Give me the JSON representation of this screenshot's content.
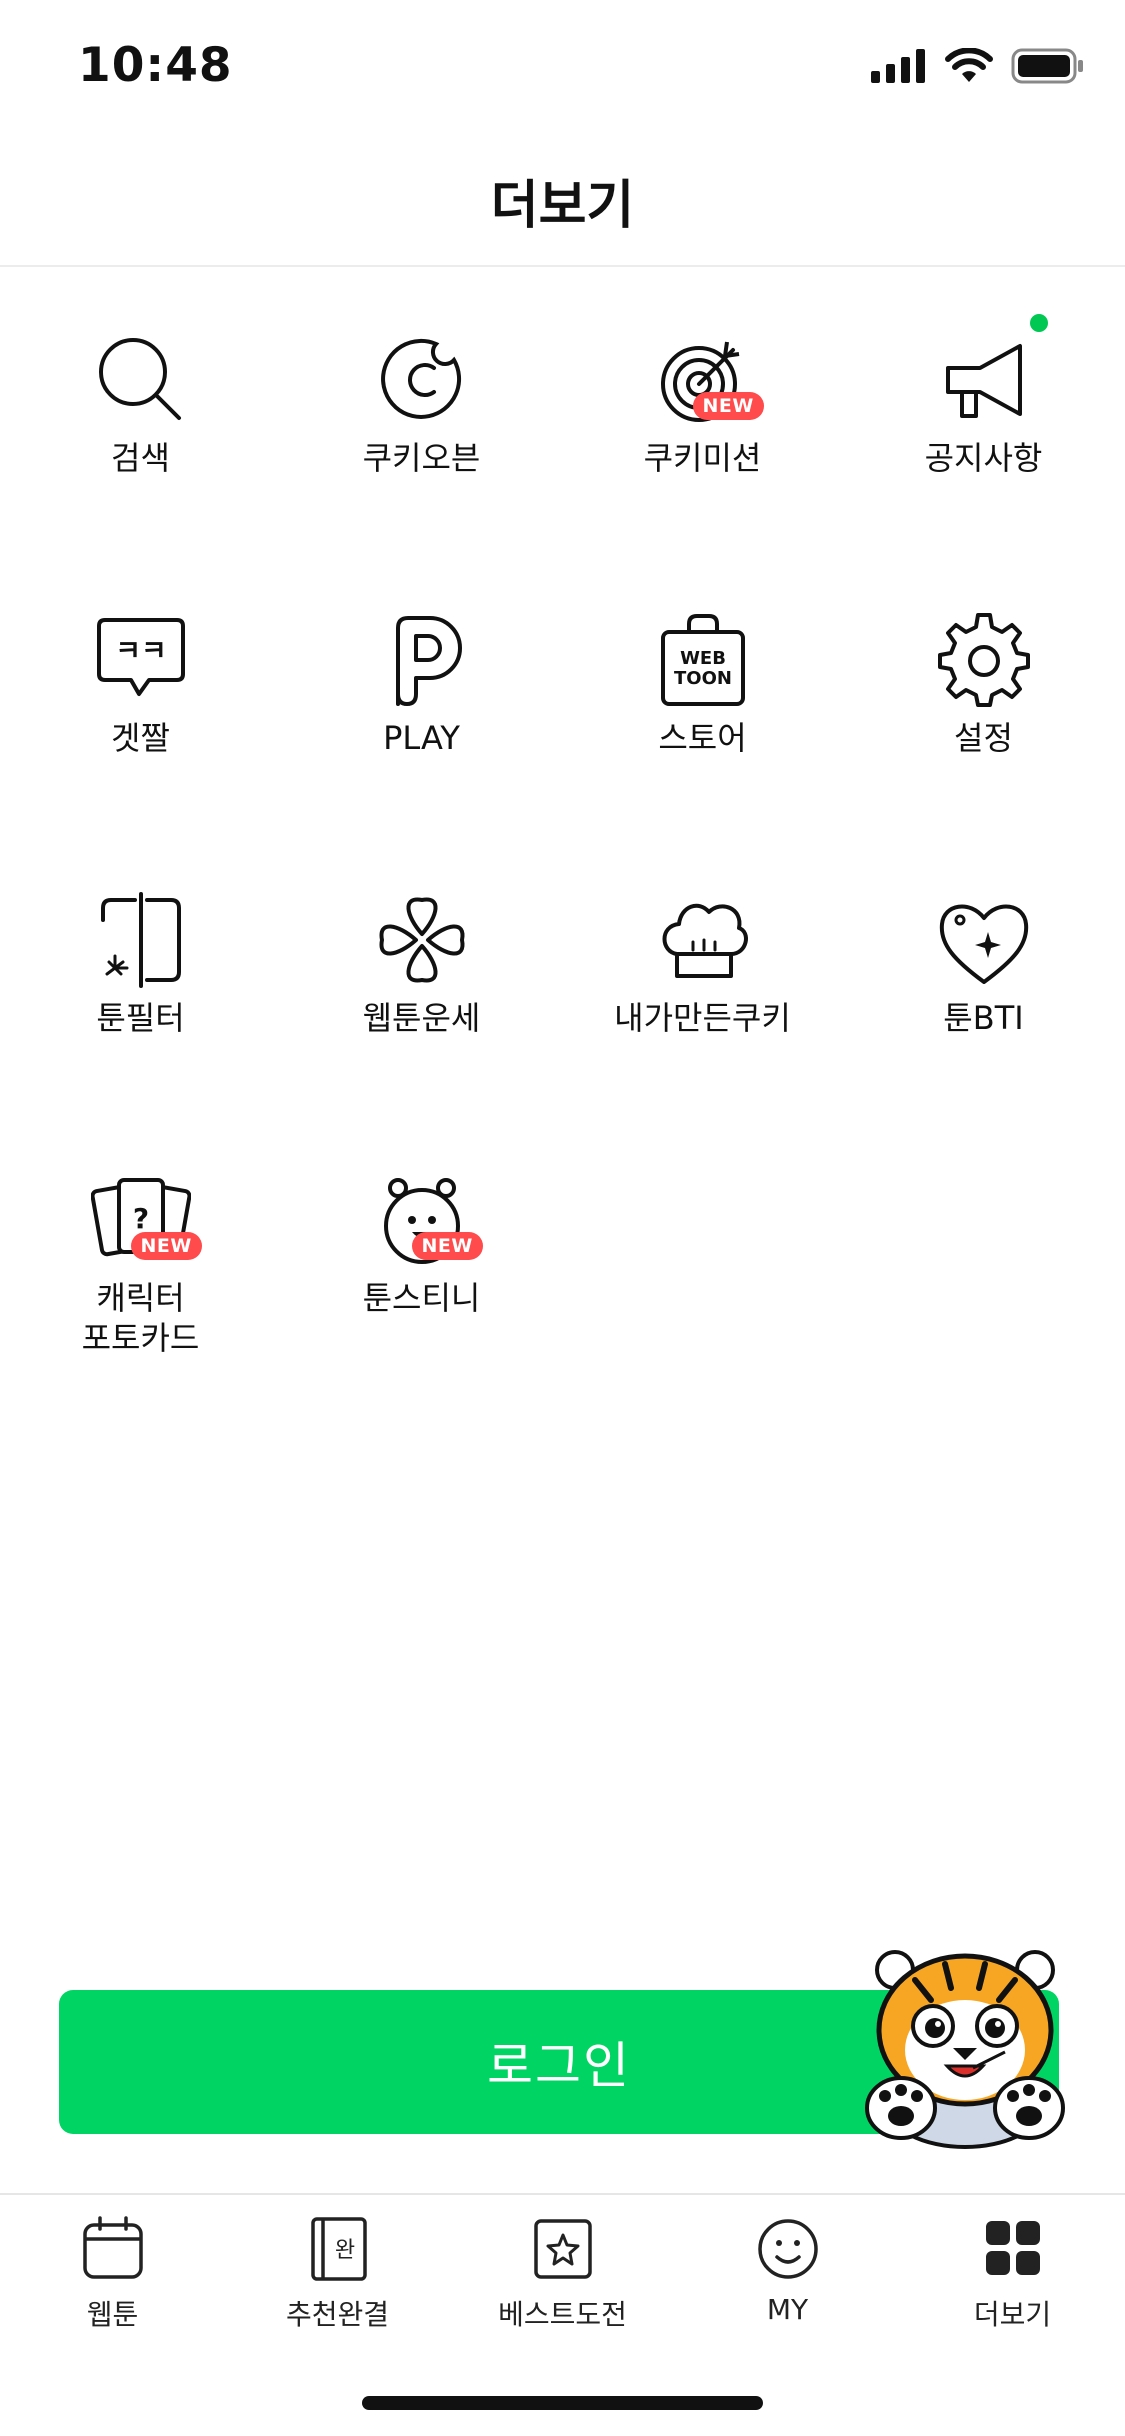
{
  "status_bar": {
    "time": "10:48"
  },
  "header": {
    "title": "더보기"
  },
  "menu": {
    "items": [
      {
        "label": "검색",
        "icon": "search-icon"
      },
      {
        "label": "쿠키오븐",
        "icon": "cookie-oven-icon"
      },
      {
        "label": "쿠키미션",
        "icon": "target-icon",
        "badge": "NEW"
      },
      {
        "label": "공지사항",
        "icon": "megaphone-icon"
      },
      {
        "label": "겟짤",
        "icon": "chat-bubble-icon",
        "icon_text": "ㅋㅋ"
      },
      {
        "label": "PLAY",
        "icon": "play-p-icon"
      },
      {
        "label": "스토어",
        "icon": "store-bag-icon",
        "icon_text_1": "WEB",
        "icon_text_2": "TOON"
      },
      {
        "label": "설정",
        "icon": "gear-icon"
      },
      {
        "label": "툰필터",
        "icon": "toon-filter-icon"
      },
      {
        "label": "웹툰운세",
        "icon": "clover-icon"
      },
      {
        "label": "내가만든쿠키",
        "icon": "chef-hat-icon"
      },
      {
        "label": "툰BTI",
        "icon": "heart-sparkle-icon"
      },
      {
        "label": "캐릭터\n포토카드",
        "icon": "photo-card-icon",
        "badge": "NEW",
        "icon_text": "?"
      },
      {
        "label": "툰스티니",
        "icon": "toonstiny-character-icon",
        "badge": "NEW"
      }
    ]
  },
  "login": {
    "label": "로그인"
  },
  "tabbar": {
    "tabs": [
      {
        "label": "웹툰",
        "icon": "calendar-icon"
      },
      {
        "label": "추천완결",
        "icon": "book-icon",
        "icon_text": "완"
      },
      {
        "label": "베스트도전",
        "icon": "star-box-icon"
      },
      {
        "label": "MY",
        "icon": "smiley-icon"
      },
      {
        "label": "더보기",
        "icon": "grid-icon"
      }
    ]
  },
  "colors": {
    "accent": "#00d564",
    "badge": "#ff4b4b",
    "notice_dot": "#00c853"
  }
}
